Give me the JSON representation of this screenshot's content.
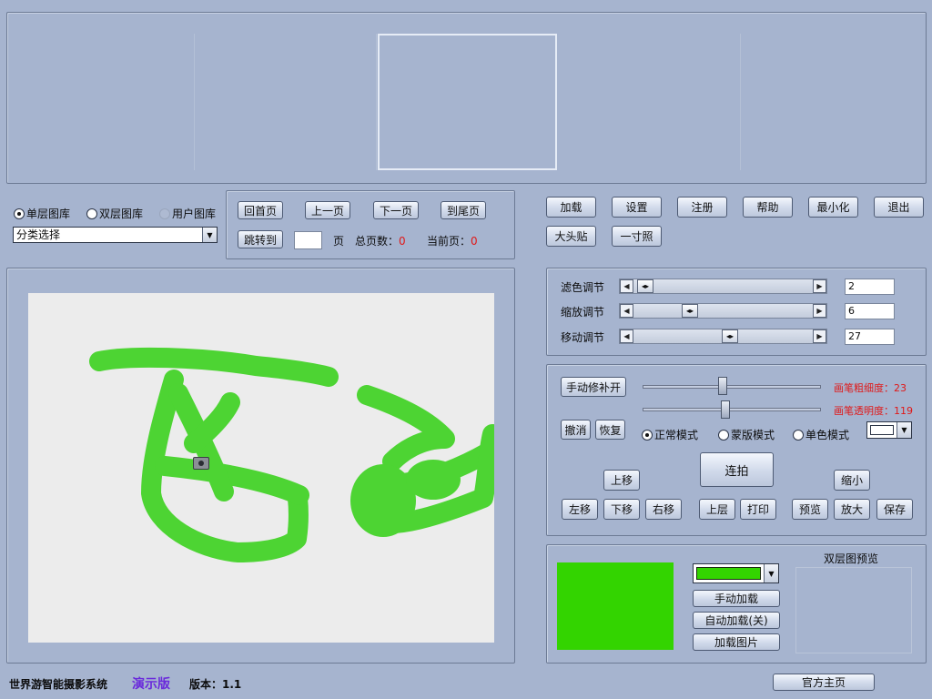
{
  "library": {
    "radios": [
      {
        "label": "单层图库",
        "selected": true,
        "enabled": true
      },
      {
        "label": "双层图库",
        "selected": false,
        "enabled": true
      },
      {
        "label": "用户图库",
        "selected": false,
        "enabled": false
      }
    ],
    "category_select": "分类选择"
  },
  "pager": {
    "first": "回首页",
    "prev": "上一页",
    "next": "下一页",
    "last": "到尾页",
    "jump": "跳转到",
    "page_input": "",
    "page_unit": "页",
    "total_label": "总页数：",
    "total_value": "0",
    "current_label": "当前页：",
    "current_value": "0"
  },
  "toolbar": {
    "load": "加载",
    "settings": "设置",
    "register": "注册",
    "help": "帮助",
    "minimize": "最小化",
    "exit": "退出",
    "sticker": "大头贴",
    "inch_photo": "一寸照"
  },
  "adjust": {
    "filter": {
      "label": "滤色调节",
      "value": "2"
    },
    "zoom": {
      "label": "缩放调节",
      "value": "6"
    },
    "move": {
      "label": "移动调节",
      "value": "27"
    }
  },
  "brush": {
    "manual_fix": "手动修补开",
    "thickness_label": "画笔粗细度：",
    "thickness_value": "23",
    "opacity_label": "画笔透明度：",
    "opacity_value": "119",
    "undo": "撤消",
    "redo": "恢复",
    "modes": [
      {
        "label": "正常模式",
        "selected": true
      },
      {
        "label": "蒙版模式",
        "selected": false
      },
      {
        "label": "单色模式",
        "selected": false
      }
    ],
    "mode_color": "#ffffff"
  },
  "controls": {
    "burst": "连拍",
    "up": "上移",
    "left": "左移",
    "down": "下移",
    "right": "右移",
    "layer_up": "上层",
    "print": "打印",
    "shrink": "缩小",
    "preview": "预览",
    "enlarge": "放大",
    "save": "保存"
  },
  "bottom_panel": {
    "bg_color": "#33d400",
    "manual_load": "手动加载",
    "auto_load": "自动加载(关)",
    "load_image": "加载图片",
    "double_preview_title": "双层图预览"
  },
  "footer": {
    "app_name": "世界游智能摄影系统",
    "edition": "演示版",
    "version": "版本：1.1",
    "homepage": "官方主页"
  },
  "canvas": {
    "stroke_color": "#4dd433",
    "background": "#ececec"
  }
}
